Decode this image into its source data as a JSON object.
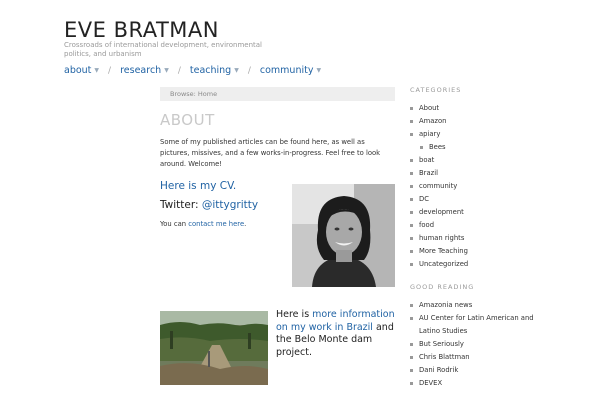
{
  "site": {
    "title": "EVE BRATMAN",
    "tagline": "Crossroads of international development, environmental politics, and urbanism"
  },
  "nav": [
    {
      "label": "about"
    },
    {
      "label": "research"
    },
    {
      "label": "teaching"
    },
    {
      "label": "community"
    }
  ],
  "nav_arrow": "▼",
  "breadcrumb": "Browse: Home",
  "page": {
    "title": "ABOUT",
    "intro": "Some of my published articles can be found here, as well as pictures, missives, and a few works-in-progress.  Feel free to look around. Welcome!",
    "cv_link": "Here is my CV.",
    "twitter_label": "Twitter: ",
    "twitter_handle": "@ittygritty",
    "contact_prefix": "You can ",
    "contact_link": "contact me here",
    "contact_suffix": ".",
    "brazil_prefix": " Here is ",
    "brazil_link": "more information on my work in Brazil",
    "brazil_suffix": " and the Belo Monte dam project."
  },
  "sidebar": {
    "categories_title": "CATEGORIES",
    "categories": [
      "About",
      "Amazon",
      "apiary",
      "Bees",
      "boat",
      "Brazil",
      "community",
      "DC",
      "development",
      "food",
      "human rights",
      "More Teaching",
      "Uncategorized"
    ],
    "good_reading_title": "GOOD READING",
    "good_reading": [
      "Amazonia news",
      "AU Center for Latin American and Latino Studies",
      "But Seriously",
      "Chris Blattman",
      "Dani Rodrik",
      "DEVEX"
    ]
  }
}
